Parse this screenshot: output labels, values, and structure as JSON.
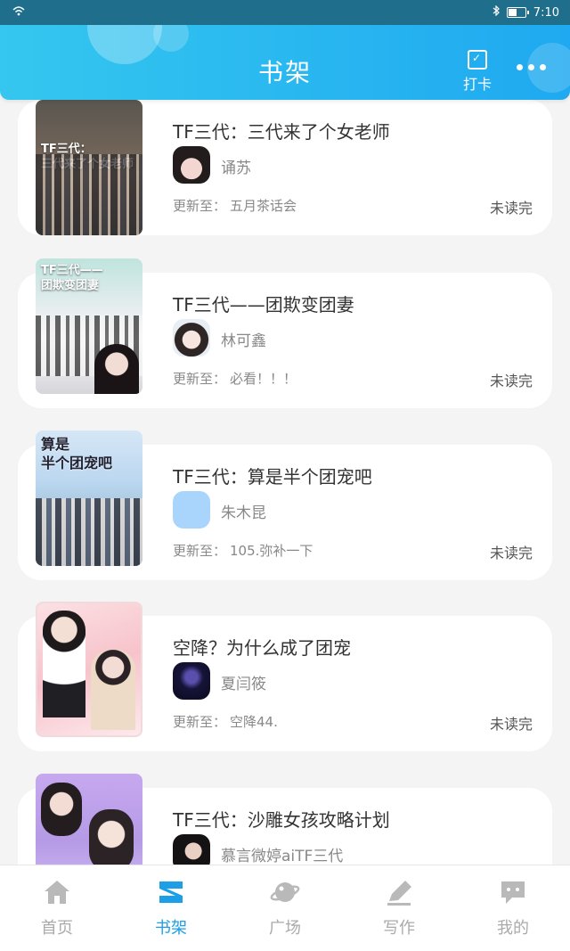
{
  "status_bar": {
    "time": "7:10"
  },
  "header": {
    "title": "书架",
    "checkin_label": "打卡"
  },
  "books": [
    {
      "title": "TF三代：三代来了个女老师",
      "author": "诵苏",
      "update_prefix": "更新至：",
      "update": "五月茶话会",
      "status": "未读完",
      "cover_caption": "TF三代：\n三代来了个女老师"
    },
    {
      "title": "TF三代——团欺变团妻",
      "author": "林可鑫",
      "update_prefix": "更新至：",
      "update": "必看！！！",
      "status": "未读完",
      "cover_caption": "TF三代——\n团欺变团妻"
    },
    {
      "title": "TF三代：算是半个团宠吧",
      "author": "朱木昆",
      "update_prefix": "更新至：",
      "update": "105.弥补一下",
      "status": "未读完",
      "cover_caption": "算是\n半个团宠吧"
    },
    {
      "title": "空降？为什么成了团宠",
      "author": "夏闫筱",
      "update_prefix": "更新至：",
      "update": "空降44.",
      "status": "未读完",
      "cover_caption": ""
    },
    {
      "title": "TF三代：沙雕女孩攻略计划",
      "author": "慕言微婷aiTF三代",
      "update_prefix": "",
      "update": "",
      "status": "",
      "cover_caption": ""
    }
  ],
  "nav": [
    {
      "label": "首页",
      "icon": "home-icon"
    },
    {
      "label": "书架",
      "icon": "bookshelf-icon",
      "active": true
    },
    {
      "label": "广场",
      "icon": "planet-icon"
    },
    {
      "label": "写作",
      "icon": "pen-icon"
    },
    {
      "label": "我的",
      "icon": "chat-bubble-icon"
    }
  ],
  "colors": {
    "accent": "#1c9fe6",
    "header_start": "#35c7ef",
    "header_end": "#1fa9f0"
  }
}
